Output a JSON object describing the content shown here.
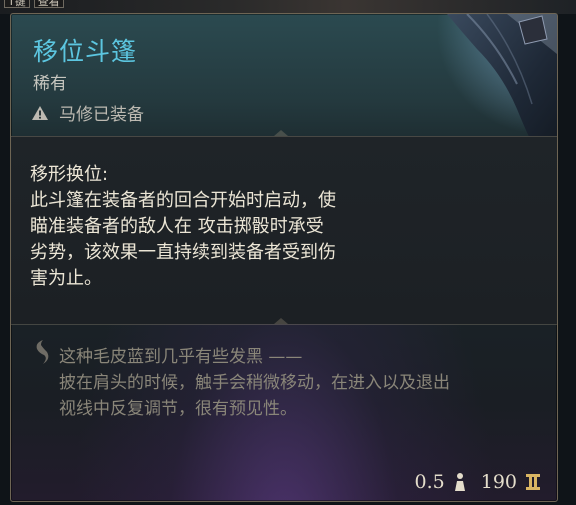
{
  "top_hint": {
    "key": "T键",
    "action": "查看"
  },
  "item": {
    "name": "移位斗篷",
    "rarity": "稀有",
    "equipped_by": "马修已装备",
    "effect_title": "移形换位:",
    "effect_lines": [
      "此斗篷在装备者的回合开始时启动，使",
      "瞄准装备者的敌人在 攻击掷骰时承受",
      "劣势，该效果一直持续到装备者受到伤",
      "害为止。"
    ],
    "lore_lines": [
      "这种毛皮蓝到几乎有些发黑 ——",
      "披在肩头的时候，触手会稍微移动，在进入以及退出",
      "视线中反复调节，很有预见性。"
    ],
    "weight": "0.5",
    "value": "190"
  },
  "colors": {
    "name": "#5cc6e0",
    "body_text": "#ece6d6",
    "lore_text": "#8a8679"
  },
  "icons": {
    "warning": "warning-icon",
    "quill": "quill-icon",
    "weight": "weight-icon",
    "gold": "gold-icon"
  }
}
